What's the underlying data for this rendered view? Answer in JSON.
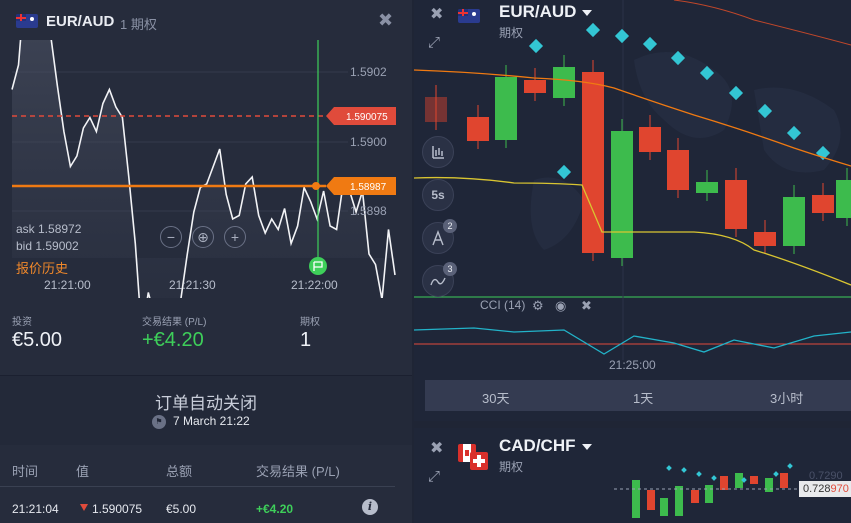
{
  "left_panel": {
    "pair": "EUR/AUD",
    "option_type": "1 期权",
    "y_ticks": [
      "1.5902",
      "1.5900",
      "1.5898"
    ],
    "x_ticks": [
      "21:21:00",
      "21:21:30",
      "21:22:00"
    ],
    "entry_tag": "1.590075",
    "current_tag": "1.58987",
    "ask": "ask 1.58972",
    "bid": "bid 1.59002",
    "history_link": "报价历史",
    "zoom": {
      "out": "−",
      "target": "⊕",
      "in": "+"
    },
    "stats": {
      "investment_label": "投资",
      "investment_value": "€5.00",
      "result_label": "交易结果 (P/L)",
      "result_value": "+€4.20",
      "options_label": "期权",
      "options_value": "1"
    },
    "auto_close": {
      "title": "订单自动关闭",
      "time": "7 March 21:22"
    },
    "table": {
      "headers": [
        "时间",
        "值",
        "总额",
        "交易结果 (P/L)"
      ],
      "row": {
        "time": "21:21:04",
        "value": "1.590075",
        "amount": "€5.00",
        "result": "+€4.20"
      }
    },
    "colors": {
      "up": "#3ecf5a",
      "down": "#e04b3b",
      "accent": "#f07a12"
    },
    "price_series": [
      1.59015,
      1.59022,
      1.59045,
      1.59062,
      1.5905,
      1.59041,
      1.5903,
      1.59016,
      1.59003,
      1.58993,
      1.58996,
      1.59004,
      1.59007,
      1.59003,
      1.59011,
      1.59015,
      1.5901,
      1.59007,
      1.5899,
      1.58971,
      1.58945,
      1.58957,
      1.5895,
      1.58945,
      1.5895,
      1.58945,
      1.58955,
      1.58968,
      1.5898,
      1.58987,
      1.58988,
      1.58993,
      1.58998,
      1.58985,
      1.58978,
      1.58979,
      1.58988,
      1.5899,
      1.58979,
      1.58974,
      1.58978,
      1.58975,
      1.58981,
      1.58971,
      1.58976,
      1.58987,
      1.58983,
      1.58978,
      1.58986,
      1.58976,
      1.58975,
      1.58988,
      1.58986,
      1.5898,
      1.58986,
      1.58968,
      1.58965,
      1.58955,
      1.58975,
      1.58962
    ]
  },
  "right_top": {
    "pair": "EUR/AUD",
    "type": "期权",
    "tools": [
      "candles-icon",
      "5s",
      "draw-icon",
      "indicator-icon"
    ],
    "tool_5s": "5s",
    "badge_draw": "2",
    "badge_ind": "3",
    "cci_label": "CCI (14)",
    "time_label": "21:25:00",
    "timeframes": [
      "30天",
      "1天",
      "3小时"
    ]
  },
  "right_bottom": {
    "pair": "CAD/CHF",
    "type": "期权",
    "price_main": "0.728",
    "price_hl": "970",
    "ghost_price": "0.7290"
  }
}
